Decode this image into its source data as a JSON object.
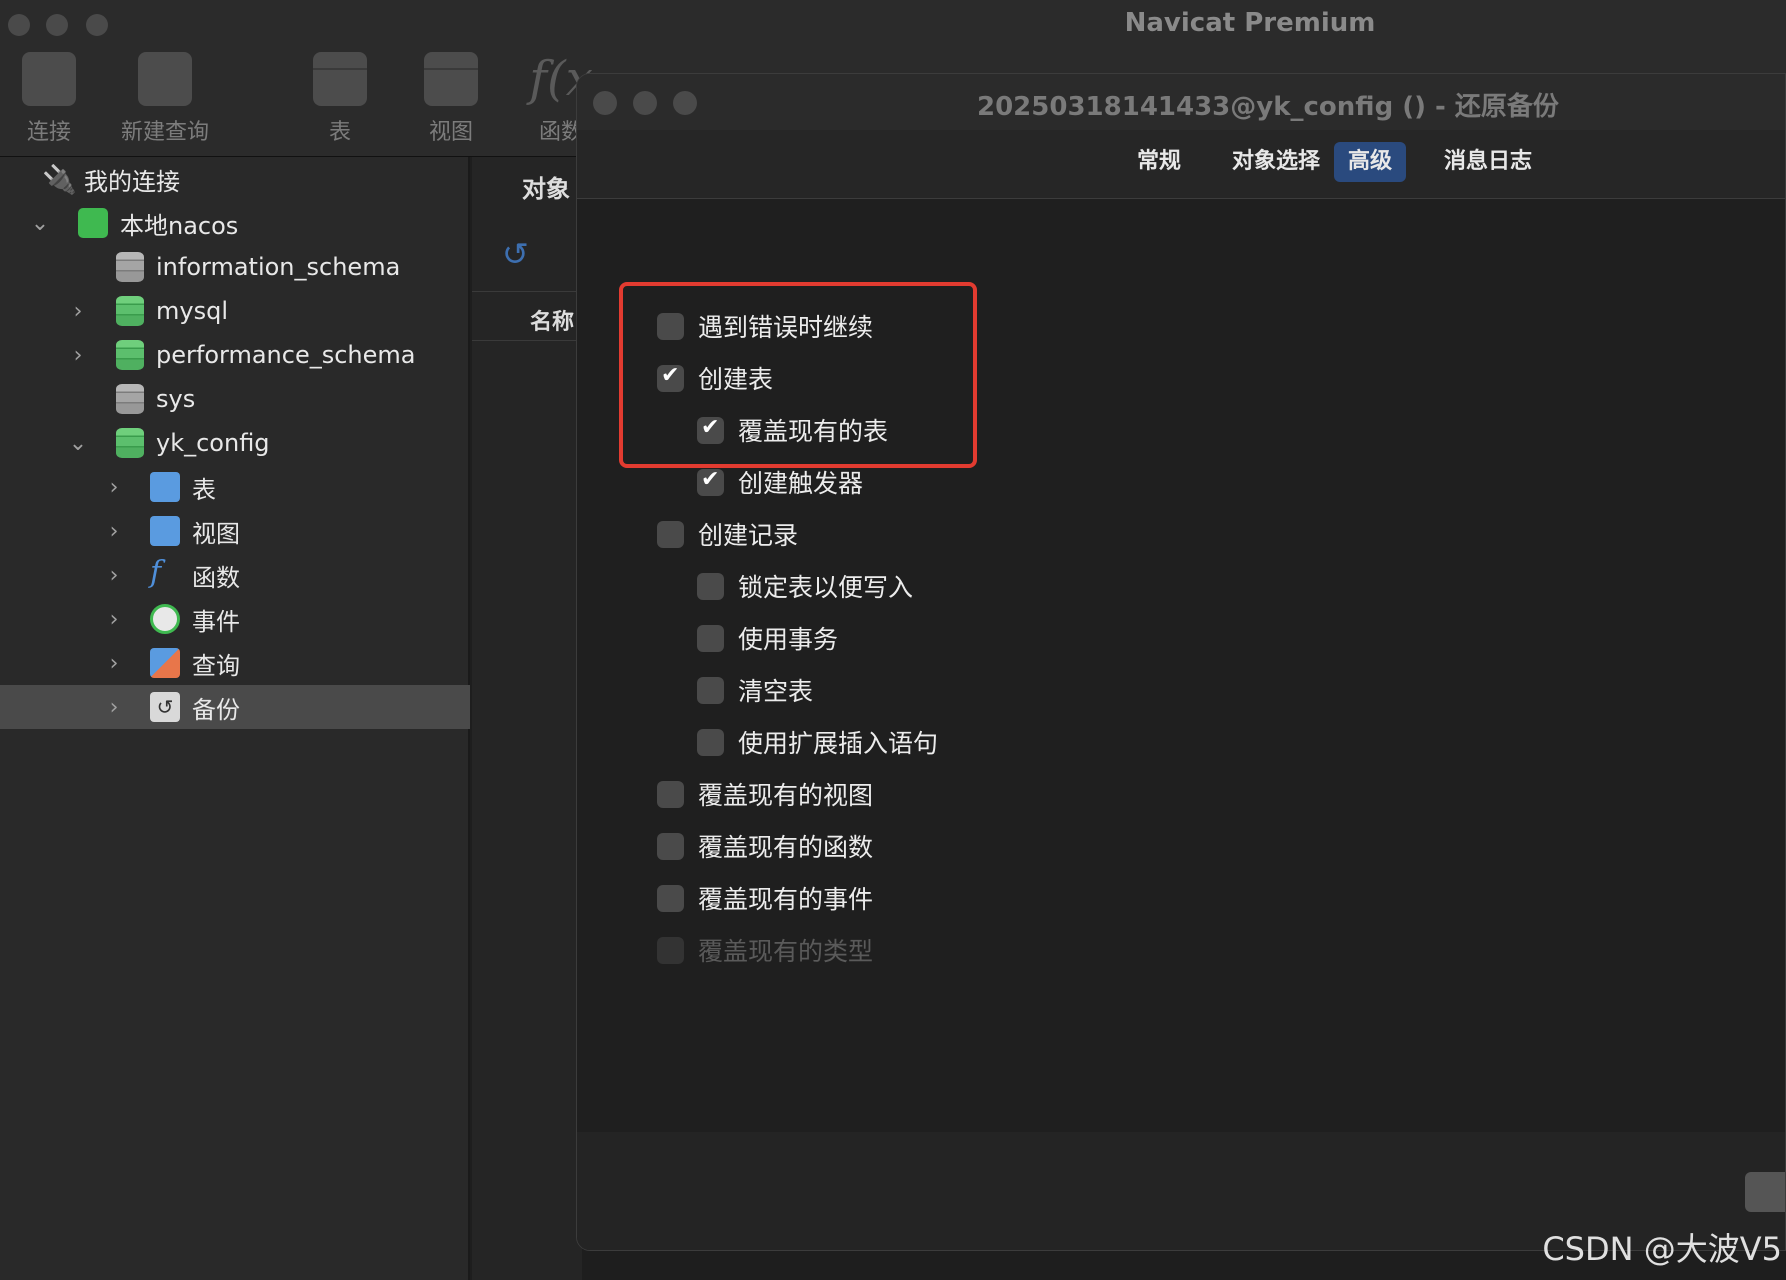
{
  "app": {
    "title": "Navicat Premium"
  },
  "toolbar": {
    "items": [
      {
        "label": "连接"
      },
      {
        "label": "新建查询"
      },
      {
        "label": "表"
      },
      {
        "label": "视图"
      },
      {
        "label": "函数"
      }
    ]
  },
  "sidebar": {
    "root": "我的连接",
    "connection": "本地nacos",
    "databases": [
      "information_schema",
      "mysql",
      "performance_schema",
      "sys",
      "yk_config"
    ],
    "objects": [
      "表",
      "视图",
      "函数",
      "事件",
      "查询",
      "备份"
    ]
  },
  "middle": {
    "objects_label": "对象",
    "name_header": "名称"
  },
  "dialog": {
    "title": "20250318141433@yk_config () - 还原备份",
    "tabs": [
      "常规",
      "对象选择",
      "高级",
      "消息日志"
    ],
    "active_tab": "高级",
    "options": [
      {
        "label": "遇到错误时继续",
        "checked": false
      },
      {
        "label": "创建表",
        "checked": true
      },
      {
        "label": "覆盖现有的表",
        "checked": true
      },
      {
        "label": "创建触发器",
        "checked": true
      },
      {
        "label": "创建记录",
        "checked": false
      },
      {
        "label": "锁定表以便写入",
        "checked": false
      },
      {
        "label": "使用事务",
        "checked": false
      },
      {
        "label": "清空表",
        "checked": false
      },
      {
        "label": "使用扩展插入语句",
        "checked": false
      },
      {
        "label": "覆盖现有的视图",
        "checked": false
      },
      {
        "label": "覆盖现有的函数",
        "checked": false
      },
      {
        "label": "覆盖现有的事件",
        "checked": false
      },
      {
        "label": "覆盖现有的类型",
        "checked": false,
        "disabled": true
      }
    ]
  },
  "watermark": "CSDN @大波V5",
  "colors": {
    "accent_tab": "#2a4a7e",
    "highlight": "#e23b30",
    "db_green": "#4fb060"
  }
}
